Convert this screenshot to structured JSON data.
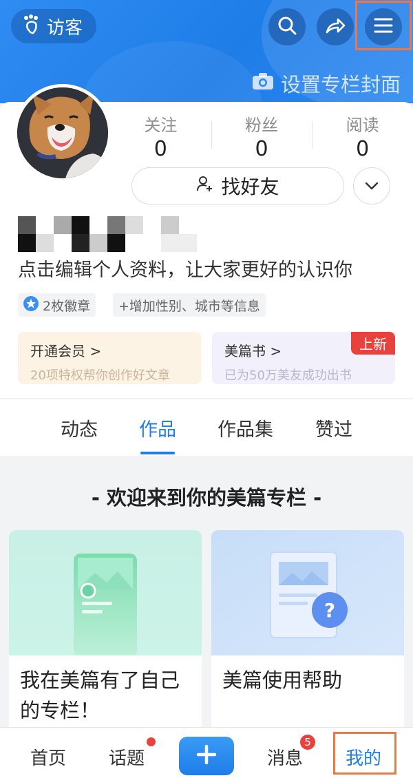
{
  "header": {
    "visitor_label": "访客",
    "cover_label": "设置专栏封面"
  },
  "profile": {
    "stats": [
      {
        "label": "关注",
        "value": "0"
      },
      {
        "label": "粉丝",
        "value": "0"
      },
      {
        "label": "阅读",
        "value": "0"
      }
    ],
    "find_friends_label": "找好友",
    "bio": "点击编辑个人资料，让大家更好的认识你",
    "badge_chip": "2枚徽章",
    "info_chip": "+增加性别、城市等信息"
  },
  "promos": {
    "vip": {
      "title": "开通会员 >",
      "subtitle": "20项特权帮你创作好文章"
    },
    "book": {
      "title": "美篇书 >",
      "subtitle": "已为50万美友成功出书",
      "tag": "上新"
    }
  },
  "tabs": [
    "动态",
    "作品",
    "作品集",
    "赞过"
  ],
  "active_tab": "作品",
  "content": {
    "welcome": "- 欢迎来到你的美篇专栏 -",
    "cards": [
      {
        "text": "我在美篇有了自己的专栏！"
      },
      {
        "text": "美篇使用帮助"
      }
    ]
  },
  "bottom_nav": {
    "home": "首页",
    "topics": "话题",
    "messages": "消息",
    "messages_badge": "5",
    "mine": "我的"
  },
  "colors": {
    "accent": "#1f7de8",
    "alert": "#e8423f",
    "highlight": "#ee7744"
  }
}
